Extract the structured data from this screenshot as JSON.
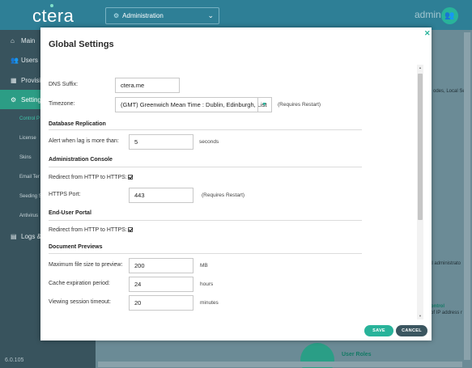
{
  "header": {
    "logo": "ctera",
    "context_select": "Administration",
    "user": "admin"
  },
  "sidebar": {
    "items": [
      {
        "label": "Main",
        "icon": "home-icon"
      },
      {
        "label": "Users",
        "icon": "users-icon"
      },
      {
        "label": "Provisio",
        "icon": "grid-icon"
      },
      {
        "label": "Settings",
        "icon": "gear-icon",
        "active": true
      },
      {
        "label": "Logs & A",
        "icon": "logs-icon"
      }
    ],
    "subitems": [
      "Control P",
      "License",
      "Skins",
      "Email Ter",
      "Seeding S",
      "Antivirus"
    ],
    "version": "6.0.105"
  },
  "background": {
    "text1": "odes, Local Serv",
    "text2": "al administrato",
    "text3": "ontrol",
    "text4": "of IP address r",
    "user_roles": "User Roles"
  },
  "modal": {
    "title": "Global Settings",
    "dns_suffix_label": "DNS Suffix:",
    "dns_suffix_value": "ctera.me",
    "timezone_label": "Timezone:",
    "timezone_value": "(GMT) Greenwich Mean Time : Dublin, Edinburgh, List",
    "requires_restart": "(Requires Restart)",
    "db_section": "Database Replication",
    "lag_label": "Alert when lag is more than:",
    "lag_value": "5",
    "lag_unit": "seconds",
    "admin_section": "Administration Console",
    "admin_redirect_label": "Redirect from HTTP to HTTPS:",
    "https_port_label": "HTTPS Port:",
    "https_port_value": "443",
    "https_restart": "(Requires Restart)",
    "portal_section": "End-User Portal",
    "portal_redirect_label": "Redirect from HTTP to HTTPS:",
    "preview_section": "Document Previews",
    "max_size_label": "Maximum file size to preview:",
    "max_size_value": "200",
    "max_size_unit": "MB",
    "cache_label": "Cache expiration period:",
    "cache_value": "24",
    "cache_unit": "hours",
    "session_label": "Viewing session timeout:",
    "session_value": "20",
    "session_unit": "minutes",
    "save": "SAVE",
    "cancel": "CANCEL"
  }
}
